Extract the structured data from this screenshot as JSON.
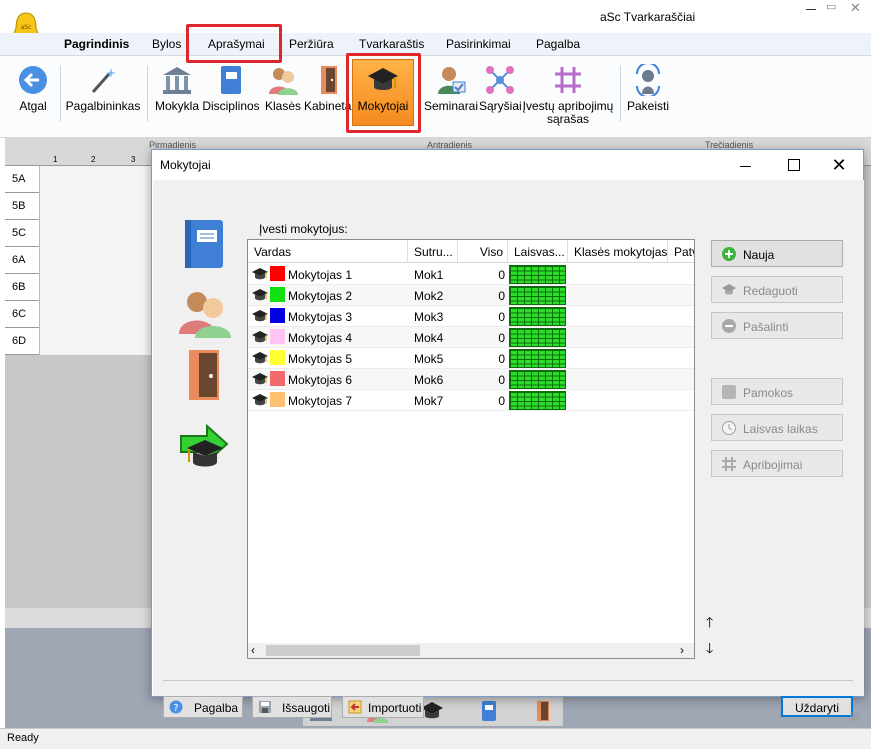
{
  "app": {
    "title": "aSc Tvarkaraščiai"
  },
  "menu": [
    "Pagrindinis",
    "Bylos",
    "Aprašymai",
    "Peržiūra",
    "Tvarkaraštis",
    "Pasirinkimai",
    "Pagalba"
  ],
  "ribbon": {
    "atgal": "Atgal",
    "pagalbininkas": "Pagalbininkas",
    "mokykla": "Mokykla",
    "disciplinos": "Disciplinos",
    "klases": "Klasės",
    "kabinetai": "Kabinetai",
    "mokytojai": "Mokytojai",
    "seminarai": "Seminarai",
    "sarysiai": "Sąryšiai",
    "apribojimai_line1": "Įvestų apribojimų",
    "apribojimai_line2": "sąrašas",
    "pakeisti": "Pakeisti"
  },
  "timetable": {
    "days": [
      "Pirmadienis",
      "Antradienis",
      "Trečiadienis"
    ],
    "periods": [
      "1",
      "2",
      "3"
    ],
    "rows": [
      "5A",
      "5B",
      "5C",
      "6A",
      "6B",
      "6C",
      "6D"
    ]
  },
  "status": "Ready",
  "dialog": {
    "title": "Mokytojai",
    "list_label": "Įvesti mokytojus:",
    "columns": [
      "Vardas",
      "Sutru...",
      "Viso",
      "Laisvas...",
      "Klasės mokytojas",
      "Patv"
    ],
    "teachers": [
      {
        "name": "Mokytojas 1",
        "short": "Mok1",
        "total": "0",
        "color": "#ff0000"
      },
      {
        "name": "Mokytojas 2",
        "short": "Mok2",
        "total": "0",
        "color": "#11e011"
      },
      {
        "name": "Mokytojas 3",
        "short": "Mok3",
        "total": "0",
        "color": "#0000e0"
      },
      {
        "name": "Mokytojas 4",
        "short": "Mok4",
        "total": "0",
        "color": "#ffc4f2"
      },
      {
        "name": "Mokytojas 5",
        "short": "Mok5",
        "total": "0",
        "color": "#ffff33"
      },
      {
        "name": "Mokytojas 6",
        "short": "Mok6",
        "total": "0",
        "color": "#f26a6a"
      },
      {
        "name": "Mokytojas 7",
        "short": "Mok7",
        "total": "0",
        "color": "#ffc070"
      }
    ],
    "buttons": {
      "nauja": "Nauja",
      "redaguoti": "Redaguoti",
      "pasalinti": "Pašalinti",
      "pamokos": "Pamokos",
      "laisvas_laikas": "Laisvas laikas",
      "apribojimai": "Apribojimai",
      "pagalba": "Pagalba",
      "issaugoti": "Išsaugoti",
      "importuoti": "Importuoti",
      "uzdaryti": "Uždaryti"
    }
  }
}
